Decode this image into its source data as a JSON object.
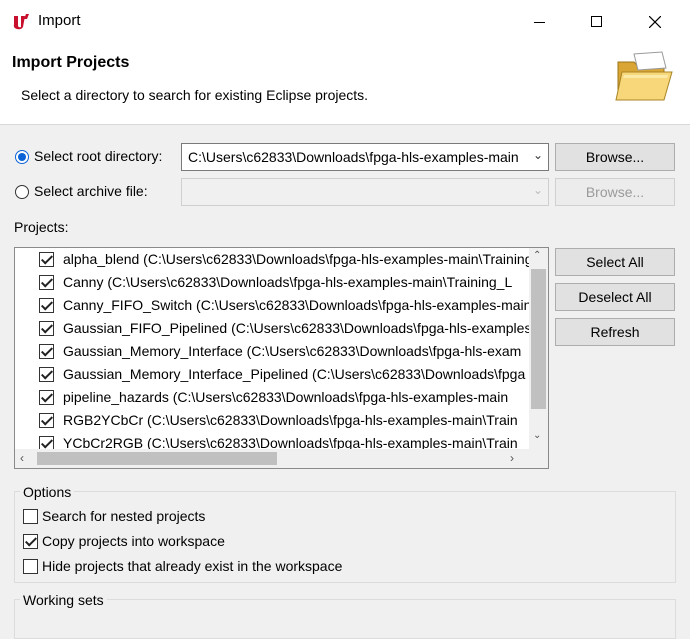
{
  "window": {
    "title": "Import",
    "minimize_icon": "minimize-icon",
    "maximize_icon": "maximize-icon",
    "close_icon": "close-icon"
  },
  "header": {
    "title": "Import Projects",
    "description": "Select a directory to search for existing Eclipse projects.",
    "icon": "folder-open-icon"
  },
  "source": {
    "root_label": "Select root directory:",
    "root_value": "C:\\Users\\c62833\\Downloads\\fpga-hls-examples-main",
    "archive_label": "Select archive file:",
    "archive_value": "",
    "browse_label": "Browse...",
    "selected": "root"
  },
  "projects": {
    "label": "Projects:",
    "items": [
      {
        "name": "alpha_blend (C:\\Users\\c62833\\Downloads\\fpga-hls-examples-main\\Training",
        "checked": true
      },
      {
        "name": "Canny (C:\\Users\\c62833\\Downloads\\fpga-hls-examples-main\\Training_L",
        "checked": true
      },
      {
        "name": "Canny_FIFO_Switch (C:\\Users\\c62833\\Downloads\\fpga-hls-examples-main",
        "checked": true
      },
      {
        "name": "Gaussian_FIFO_Pipelined (C:\\Users\\c62833\\Downloads\\fpga-hls-examples",
        "checked": true
      },
      {
        "name": "Gaussian_Memory_Interface (C:\\Users\\c62833\\Downloads\\fpga-hls-exam",
        "checked": true
      },
      {
        "name": "Gaussian_Memory_Interface_Pipelined (C:\\Users\\c62833\\Downloads\\fpga",
        "checked": true
      },
      {
        "name": "pipeline_hazards (C:\\Users\\c62833\\Downloads\\fpga-hls-examples-main",
        "checked": true
      },
      {
        "name": "RGB2YCbCr (C:\\Users\\c62833\\Downloads\\fpga-hls-examples-main\\Train",
        "checked": true
      },
      {
        "name": "YCbCr2RGB (C:\\Users\\c62833\\Downloads\\fpga-hls-examples-main\\Train",
        "checked": true
      }
    ]
  },
  "buttons": {
    "select_all": "Select All",
    "deselect_all": "Deselect All",
    "refresh": "Refresh"
  },
  "options": {
    "legend": "Options",
    "search_nested": "Search for nested projects",
    "copy_projects": "Copy projects into workspace",
    "hide_existing": "Hide projects that already exist in the workspace",
    "search_nested_checked": false,
    "copy_projects_checked": true,
    "hide_existing_checked": false
  },
  "working_sets": {
    "legend": "Working sets"
  },
  "colors": {
    "accent": "#0a64d8",
    "logo": "#c8102e"
  }
}
